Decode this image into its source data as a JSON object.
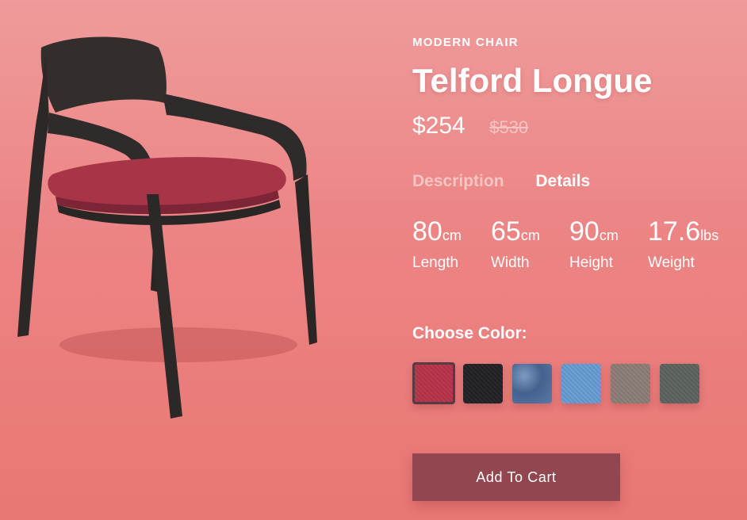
{
  "product": {
    "category": "MODERN CHAIR",
    "name": "Telford Longue",
    "price": "$254",
    "old_price": "$530"
  },
  "tabs": [
    {
      "label": "Description",
      "active": false
    },
    {
      "label": "Details",
      "active": true
    }
  ],
  "specs": [
    {
      "value": "80",
      "unit": "cm",
      "label": "Length"
    },
    {
      "value": "65",
      "unit": "cm",
      "label": "Width"
    },
    {
      "value": "90",
      "unit": "cm",
      "label": "Height"
    },
    {
      "value": "17.6",
      "unit": "lbs",
      "label": "Weight"
    }
  ],
  "color_picker": {
    "label": "Choose Color:",
    "options": [
      {
        "name": "red",
        "hex": "#b3364b",
        "selected": true
      },
      {
        "name": "black",
        "hex": "#242426",
        "selected": false
      },
      {
        "name": "denim",
        "hex": "#53709c",
        "selected": false
      },
      {
        "name": "light-blue",
        "hex": "#659acd",
        "selected": false
      },
      {
        "name": "taupe",
        "hex": "#8a7d75",
        "selected": false
      },
      {
        "name": "gray",
        "hex": "#5c625e",
        "selected": false
      }
    ]
  },
  "cart": {
    "button_label": "Add To Cart"
  },
  "colors": {
    "background": "#ec8484",
    "button": "#924650",
    "inactive_tab": "#f7c3c3",
    "chair_frame": "#2e2a29",
    "chair_seat": "#a83448"
  },
  "icons": {
    "product_image": "chair-illustration"
  }
}
